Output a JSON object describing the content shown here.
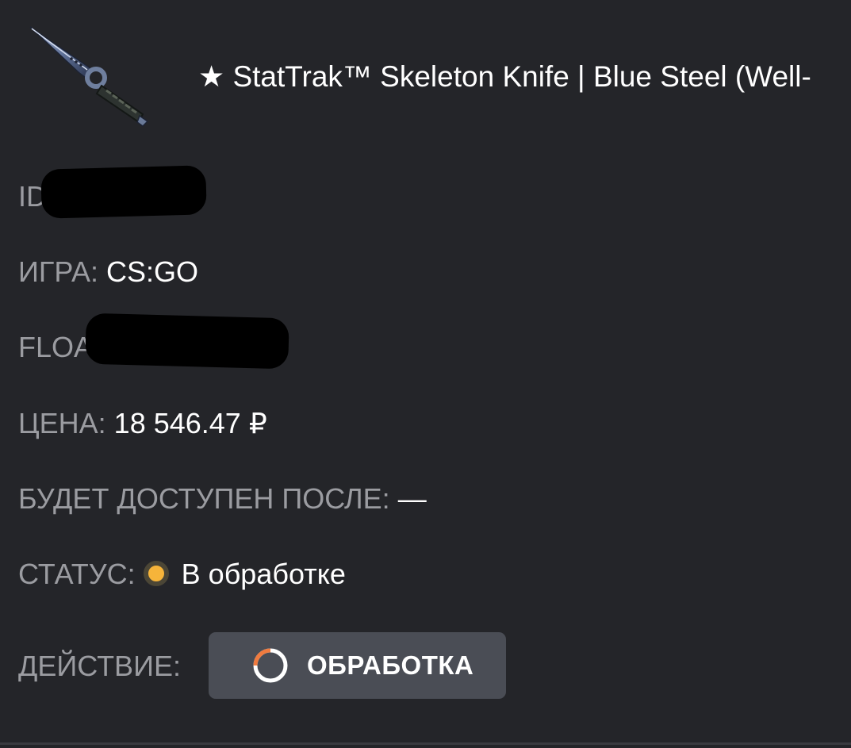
{
  "item": {
    "title": "★ StatTrak™ Skeleton Knife | Blue Steel (Well-",
    "image_icon": "skeleton-knife-icon"
  },
  "details": {
    "id_label": "ID:",
    "game_label": "ИГРА:",
    "game_value": "CS:GO",
    "float_label": "FLOAT:",
    "price_label": "ЦЕНА:",
    "price_value": "18 546.47 ₽",
    "available_label": "БУДЕТ ДОСТУПЕН ПОСЛЕ:",
    "available_value": "—",
    "status_label": "СТАТУС:",
    "status_value": "В обработке",
    "status_color": "#f6b43a",
    "action_label": "ДЕЙСТВИЕ:",
    "action_button": "ОБРАБОТКА",
    "action_icon": "loading-spinner-icon"
  },
  "colors": {
    "background": "#242529",
    "label": "#9b9ca1",
    "button": "#4a4d55",
    "spinner_accent": "#f07b3f"
  }
}
